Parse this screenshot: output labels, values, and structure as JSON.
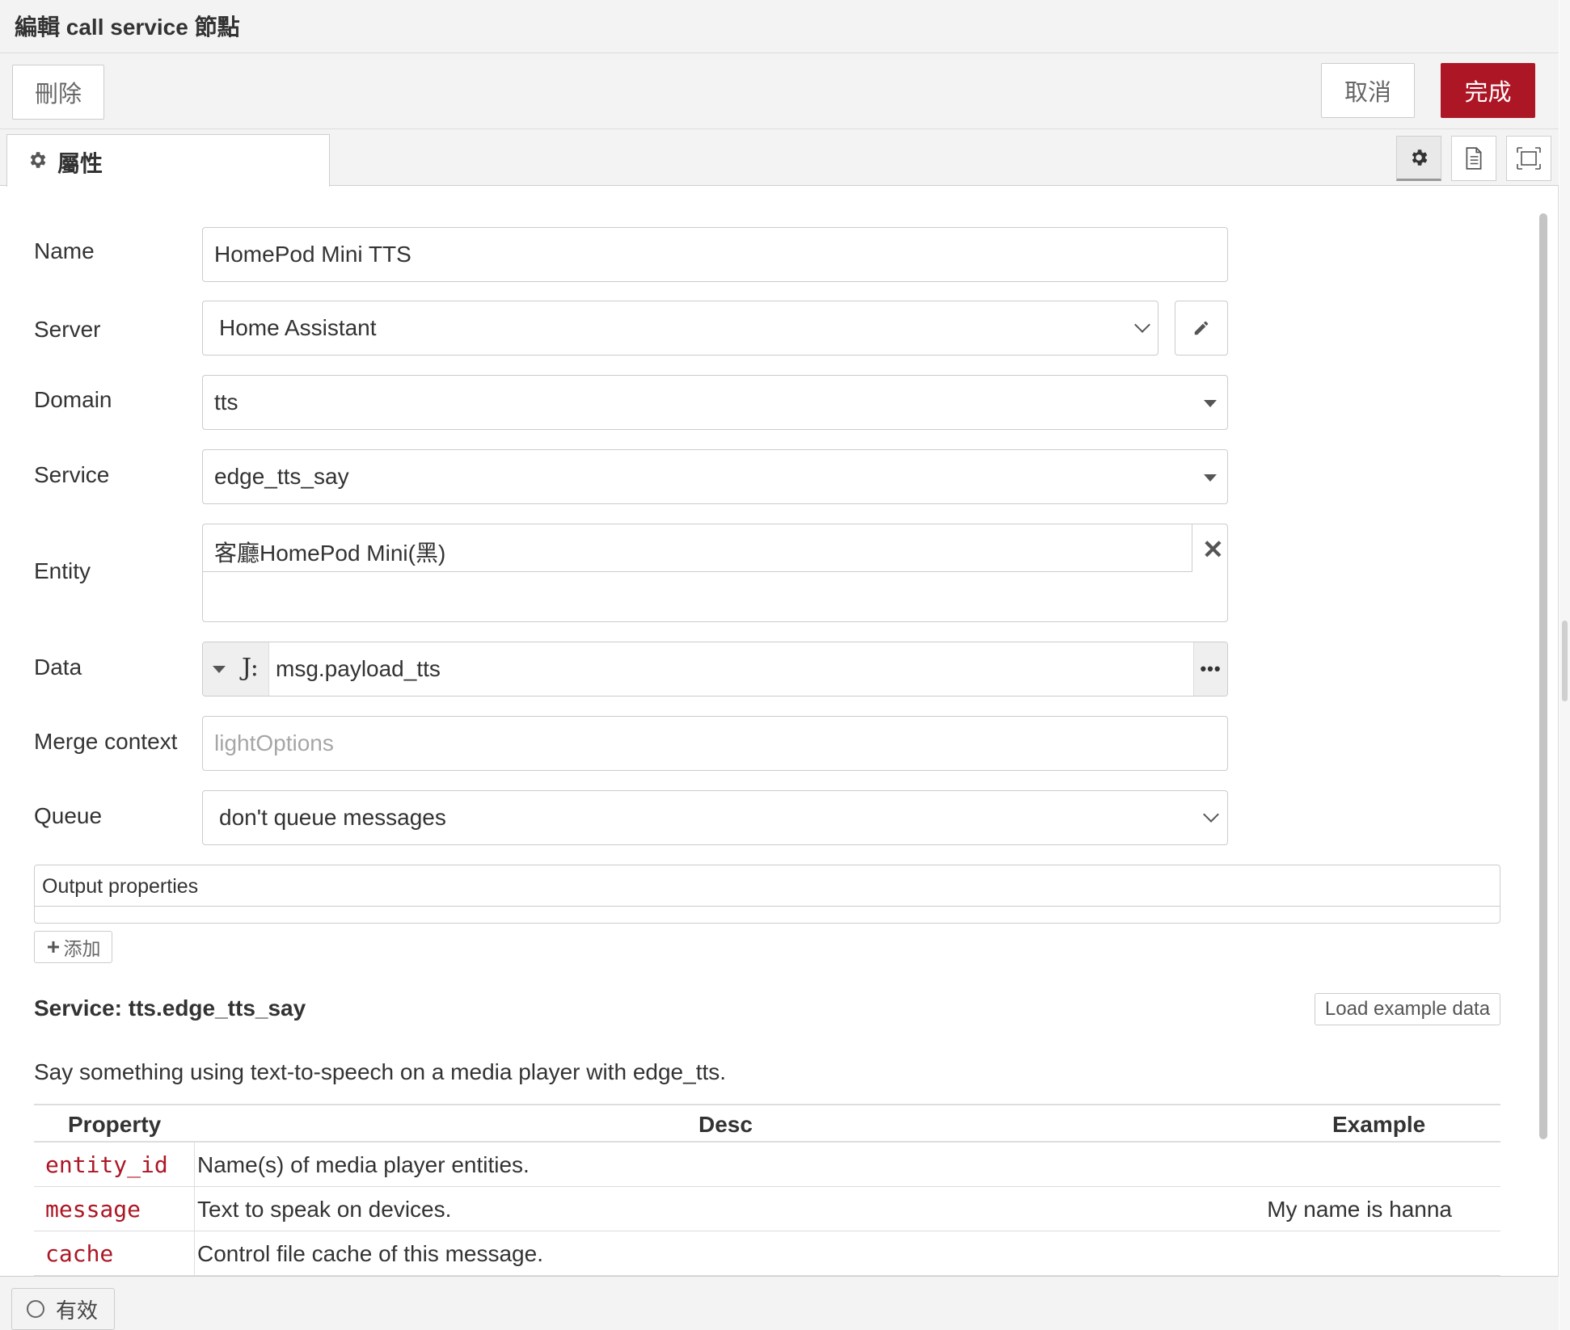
{
  "window": {
    "title": "編輯 call service 節點"
  },
  "toolbar": {
    "delete_label": "刪除",
    "cancel_label": "取消",
    "done_label": "完成"
  },
  "tabs": [
    {
      "label": "屬性",
      "icon": "gear-icon"
    }
  ],
  "tool_icons": [
    "gear-icon",
    "document-icon",
    "frame-icon"
  ],
  "form": {
    "name": {
      "label": "Name",
      "value": "HomePod Mini TTS"
    },
    "server": {
      "label": "Server",
      "value": "Home Assistant",
      "edit_icon": "pencil-icon"
    },
    "domain": {
      "label": "Domain",
      "value": "tts"
    },
    "service": {
      "label": "Service",
      "value": "edge_tts_say"
    },
    "entity": {
      "label": "Entity",
      "value": "客廳HomePod Mini(黑)",
      "remove_glyph": "✕"
    },
    "data": {
      "label": "Data",
      "type_glyph": "J:",
      "value": "msg.payload_tts",
      "more_glyph": "•••"
    },
    "merge_context": {
      "label": "Merge context",
      "placeholder": "lightOptions"
    },
    "queue": {
      "label": "Queue",
      "value": "don't queue messages"
    }
  },
  "output_properties": {
    "header": "Output properties",
    "add_label": "添加"
  },
  "service_info": {
    "title": "Service: tts.edge_tts_say",
    "load_button": "Load example data",
    "description": "Say something using text-to-speech on a media player with edge_tts.",
    "table": {
      "headers": [
        "Property",
        "Desc",
        "Example"
      ],
      "rows": [
        {
          "property": "entity_id",
          "desc": "Name(s) of media player entities.",
          "example": ""
        },
        {
          "property": "message",
          "desc": "Text to speak on devices.",
          "example": "My name is hanna"
        },
        {
          "property": "cache",
          "desc": "Control file cache of this message.",
          "example": ""
        }
      ]
    }
  },
  "footer": {
    "enabled_label": "有效"
  },
  "colors": {
    "primary": "#ad1625",
    "border": "#cccccc",
    "panel": "#f3f3f3"
  }
}
